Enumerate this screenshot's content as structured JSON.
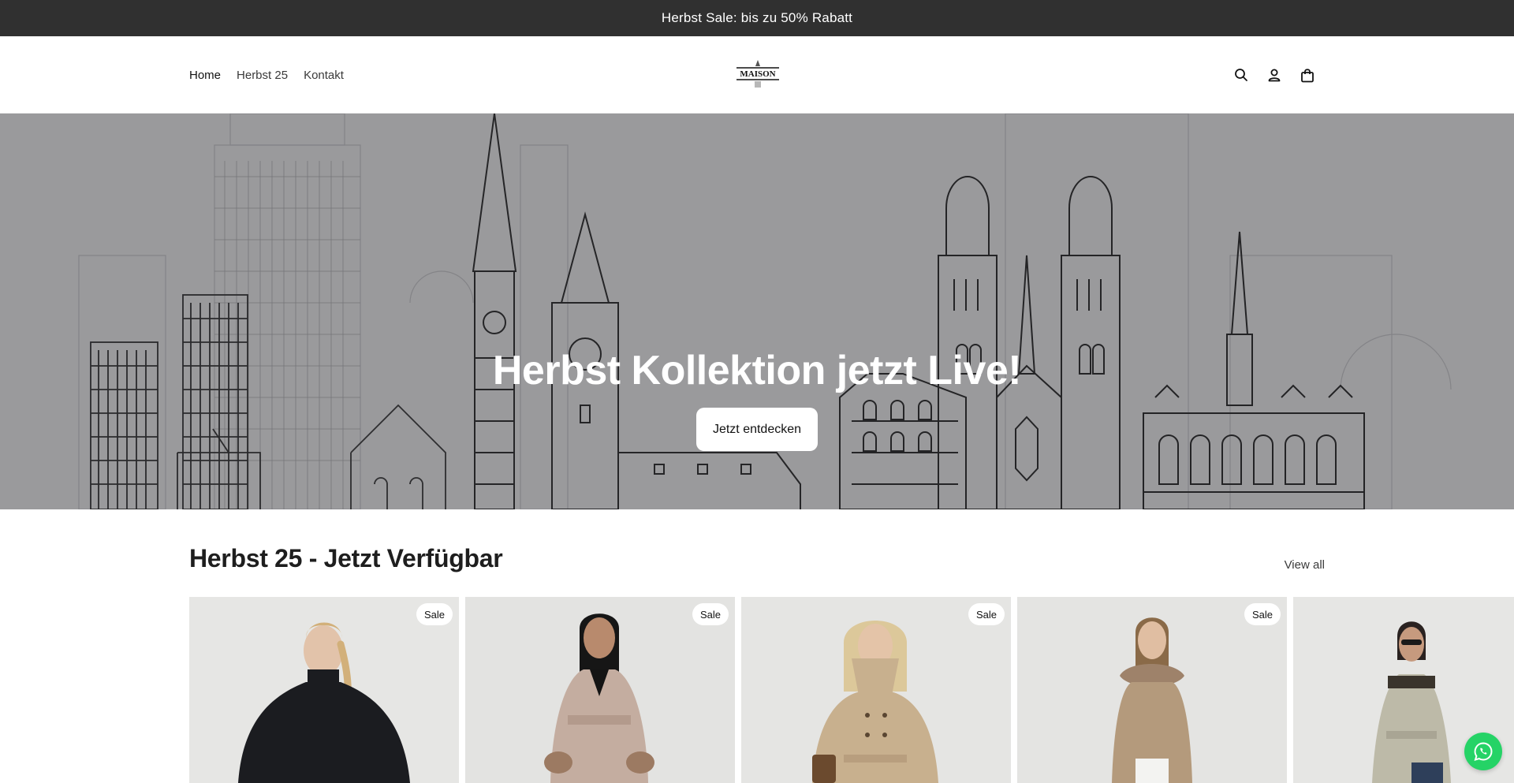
{
  "announcement": {
    "text": "Herbst Sale: bis zu 50% Rabatt"
  },
  "header": {
    "nav": [
      {
        "label": "Home"
      },
      {
        "label": "Herbst 25"
      },
      {
        "label": "Kontakt"
      }
    ],
    "logo_text": "MAISON",
    "icons": [
      "search-icon",
      "account-icon",
      "cart-icon"
    ]
  },
  "hero": {
    "title": "Herbst Kollektion jetzt Live!",
    "button_label": "Jetzt entdecken"
  },
  "collection": {
    "title": "Herbst 25 - Jetzt Verfügbar",
    "view_all_label": "View all",
    "products": [
      {
        "badge": "Sale",
        "coat_color": "#1b1c20"
      },
      {
        "badge": "Sale",
        "coat_color": "#c4ada0"
      },
      {
        "badge": "Sale",
        "coat_color": "#c8b08e"
      },
      {
        "badge": "Sale",
        "coat_color": "#b49a7c"
      },
      {
        "badge": "",
        "coat_color": "#bdbaa8"
      }
    ]
  },
  "colors": {
    "announcement_bg": "#303030",
    "hero_bg": "#9a9a9c",
    "whatsapp": "#25d366"
  }
}
